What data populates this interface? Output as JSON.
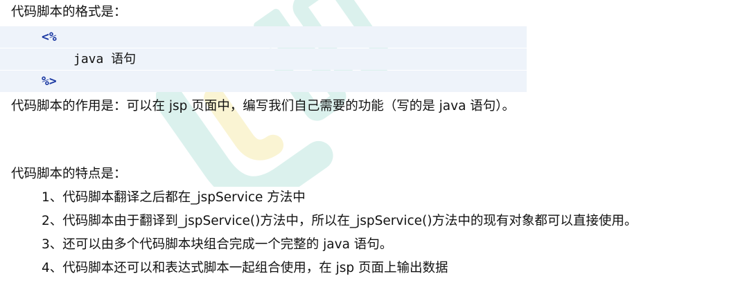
{
  "format_heading": "代码脚本的格式是：",
  "code": {
    "open_tag": "<%",
    "statement": "java 语句",
    "close_tag": "%>"
  },
  "purpose_text": "代码脚本的作用是：可以在 jsp 页面中，编写我们自己需要的功能（写的是 java 语句）。",
  "features_heading": "代码脚本的特点是：",
  "features": [
    "1、代码脚本翻译之后都在_jspService 方法中",
    "2、代码脚本由于翻译到_jspService()方法中，所以在_jspService()方法中的现有对象都可以直接使用。",
    "3、还可以由多个代码脚本块组合完成一个完整的 java 语句。",
    "4、代码脚本还可以和表达式脚本一起组合使用，在 jsp 页面上输出数据"
  ],
  "colors": {
    "watermark_teal": "#bfe6df",
    "watermark_yellow": "#f6ecb0",
    "code_tag": "#1c3aa3",
    "code_bg": "#eef3fa"
  }
}
